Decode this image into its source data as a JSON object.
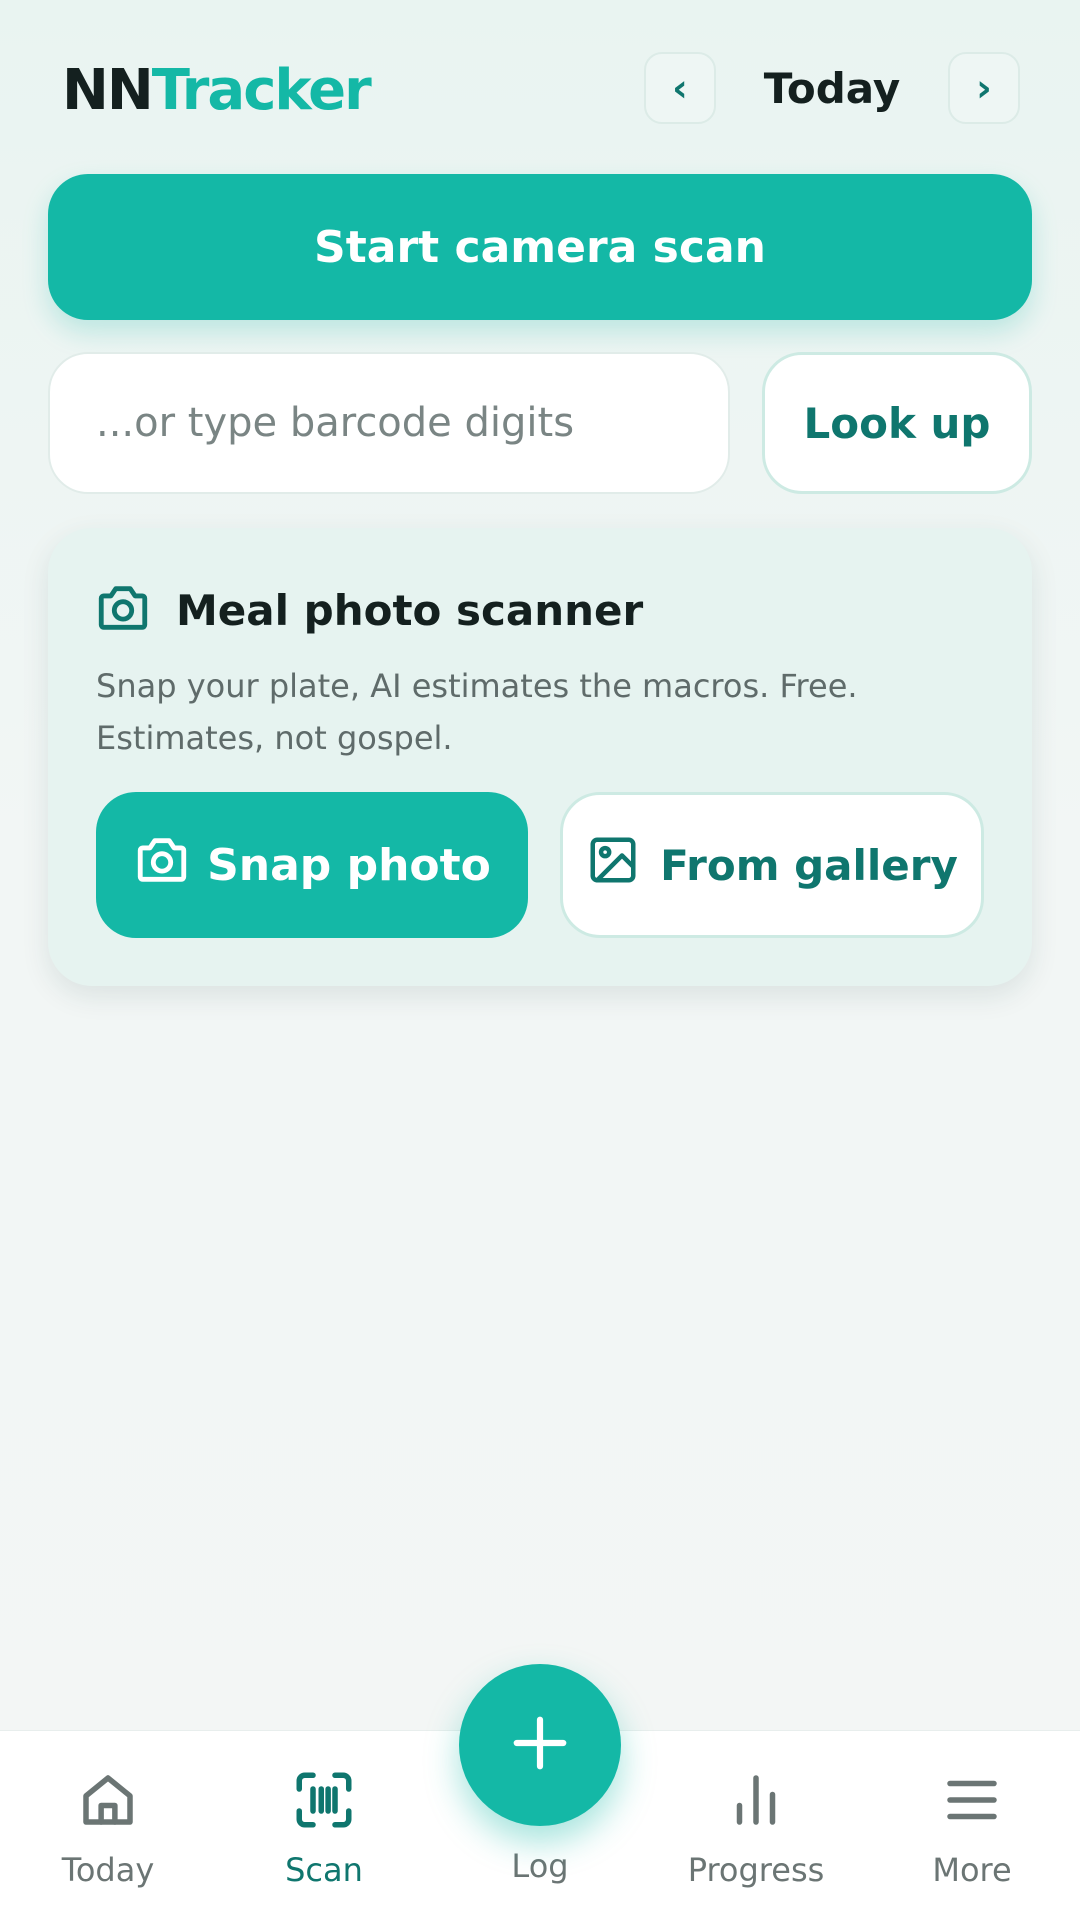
{
  "header": {
    "logo_part1": "NN",
    "logo_part2": "Tracker",
    "prev_label": "‹",
    "next_label": "›",
    "date_label": "Today"
  },
  "scan": {
    "camera_button": "Start camera scan",
    "barcode_placeholder": "...or type barcode digits",
    "lookup_button": "Look up"
  },
  "meal_card": {
    "title": "Meal photo scanner",
    "description": "Snap your plate, AI estimates the macros. Free. Estimates, not gospel.",
    "snap_button": "Snap photo",
    "gallery_button": "From gallery"
  },
  "bottom_nav": {
    "items": [
      {
        "label": "Today",
        "icon": "home-icon"
      },
      {
        "label": "Scan",
        "icon": "barcode-icon",
        "active": true
      },
      {
        "label": "Log",
        "icon": "plus-icon"
      },
      {
        "label": "Progress",
        "icon": "bar-chart-icon"
      },
      {
        "label": "More",
        "icon": "menu-icon"
      }
    ]
  },
  "colors": {
    "accent": "#14b8a6",
    "accent_dark": "#0f766e",
    "text": "#14201f",
    "muted": "#6b7574"
  }
}
